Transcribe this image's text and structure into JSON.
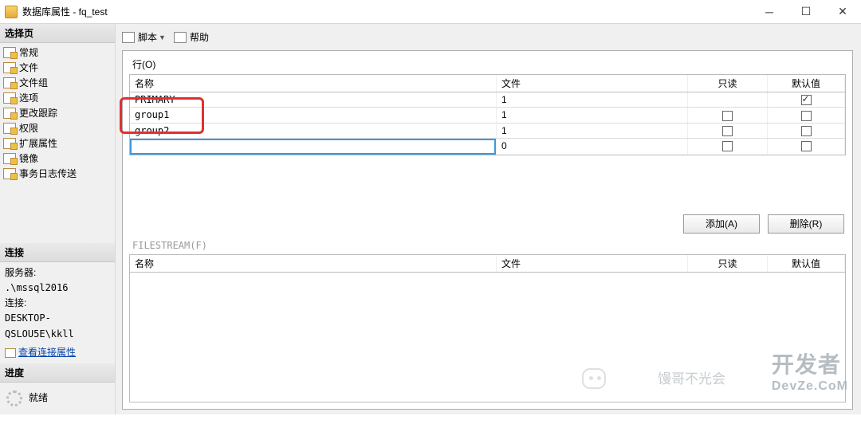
{
  "window": {
    "title": "数据库属性 - fq_test"
  },
  "sidebar": {
    "select_page_header": "选择页",
    "pages": [
      {
        "label": "常规"
      },
      {
        "label": "文件"
      },
      {
        "label": "文件组"
      },
      {
        "label": "选项"
      },
      {
        "label": "更改跟踪"
      },
      {
        "label": "权限"
      },
      {
        "label": "扩展属性"
      },
      {
        "label": "镜像"
      },
      {
        "label": "事务日志传送"
      }
    ],
    "connection_header": "连接",
    "server_label": "服务器:",
    "server_value": ".\\mssql2016",
    "conn_label": "连接:",
    "conn_value": "DESKTOP-QSLOU5E\\kkll",
    "view_conn_props": "查看连接属性",
    "progress_header": "进度",
    "progress_status": "就绪"
  },
  "toolbar": {
    "script_label": "脚本",
    "help_label": "帮助"
  },
  "main": {
    "rows_label": "行(O)",
    "cols": {
      "name": "名称",
      "file": "文件",
      "ro": "只读",
      "def": "默认值"
    },
    "rows": [
      {
        "name": "PRIMARY",
        "files": "1",
        "ro": null,
        "def": true
      },
      {
        "name": "group1",
        "files": "1",
        "ro": false,
        "def": false
      },
      {
        "name": "group2",
        "files": "1",
        "ro": false,
        "def": false
      }
    ],
    "new_row_files": "0",
    "add_btn": "添加(A)",
    "remove_btn": "删除(R)",
    "filestream_label": "FILESTREAM(F)",
    "fs_cols": {
      "name": "名称",
      "file": "文件",
      "ro": "只读",
      "def": "默认值"
    }
  },
  "watermark": {
    "line1": "开发者",
    "line2": "DevZe.CoM",
    "ghost_text": "馒哥不光会"
  }
}
